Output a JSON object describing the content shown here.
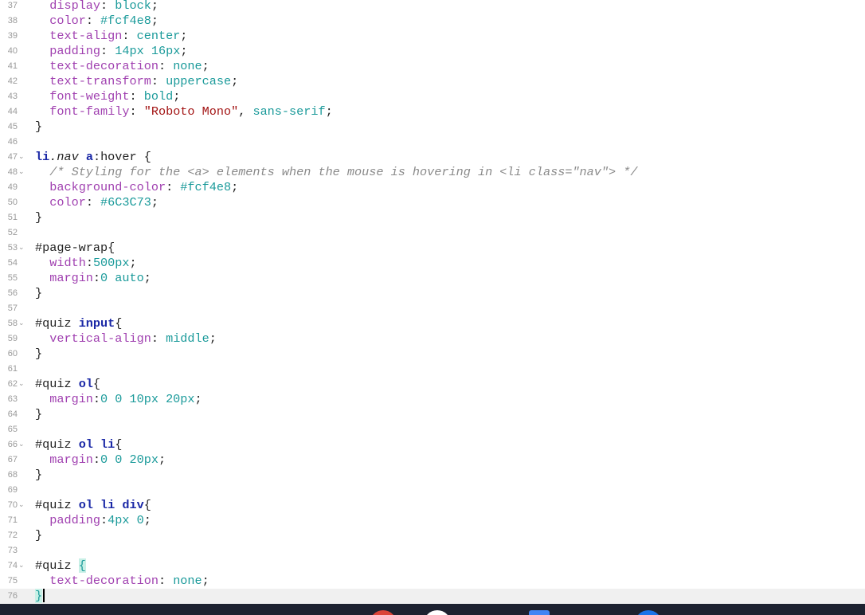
{
  "editor": {
    "lines": [
      {
        "n": "37",
        "fold": "",
        "tokens": [
          [
            "",
            "  "
          ],
          [
            "prop",
            "display"
          ],
          [
            "",
            ": "
          ],
          [
            "val",
            "block"
          ],
          [
            "",
            ";"
          ]
        ]
      },
      {
        "n": "38",
        "fold": "",
        "tokens": [
          [
            "",
            "  "
          ],
          [
            "prop",
            "color"
          ],
          [
            "",
            ": "
          ],
          [
            "val",
            "#fcf4e8"
          ],
          [
            "",
            ";"
          ]
        ]
      },
      {
        "n": "39",
        "fold": "",
        "tokens": [
          [
            "",
            "  "
          ],
          [
            "prop",
            "text-align"
          ],
          [
            "",
            ": "
          ],
          [
            "val",
            "center"
          ],
          [
            "",
            ";"
          ]
        ]
      },
      {
        "n": "40",
        "fold": "",
        "tokens": [
          [
            "",
            "  "
          ],
          [
            "prop",
            "padding"
          ],
          [
            "",
            ": "
          ],
          [
            "val",
            "14px 16px"
          ],
          [
            "",
            ";"
          ]
        ]
      },
      {
        "n": "41",
        "fold": "",
        "tokens": [
          [
            "",
            "  "
          ],
          [
            "prop",
            "text-decoration"
          ],
          [
            "",
            ": "
          ],
          [
            "val",
            "none"
          ],
          [
            "",
            ";"
          ]
        ]
      },
      {
        "n": "42",
        "fold": "",
        "tokens": [
          [
            "",
            "  "
          ],
          [
            "prop",
            "text-transform"
          ],
          [
            "",
            ": "
          ],
          [
            "val",
            "uppercase"
          ],
          [
            "",
            ";"
          ]
        ]
      },
      {
        "n": "43",
        "fold": "",
        "tokens": [
          [
            "",
            "  "
          ],
          [
            "prop",
            "font-weight"
          ],
          [
            "",
            ": "
          ],
          [
            "val",
            "bold"
          ],
          [
            "",
            ";"
          ]
        ]
      },
      {
        "n": "44",
        "fold": "",
        "tokens": [
          [
            "",
            "  "
          ],
          [
            "prop",
            "font-family"
          ],
          [
            "",
            ": "
          ],
          [
            "str",
            "\"Roboto Mono\""
          ],
          [
            "",
            ", "
          ],
          [
            "val",
            "sans-serif"
          ],
          [
            "",
            ";"
          ]
        ]
      },
      {
        "n": "45",
        "fold": "",
        "tokens": [
          [
            "",
            "}"
          ]
        ]
      },
      {
        "n": "46",
        "fold": "",
        "tokens": []
      },
      {
        "n": "47",
        "fold": "⌄",
        "tokens": [
          [
            "kw",
            "li"
          ],
          [
            "cls",
            ".nav"
          ],
          [
            "",
            " "
          ],
          [
            "kw",
            "a"
          ],
          [
            "",
            ":hover {"
          ]
        ]
      },
      {
        "n": "48",
        "fold": "⌄",
        "tokens": [
          [
            "",
            "  "
          ],
          [
            "cmt",
            "/* Styling for the <a> elements when the mouse is hovering in <li class=\"nav\"> */"
          ]
        ]
      },
      {
        "n": "49",
        "fold": "",
        "tokens": [
          [
            "",
            "  "
          ],
          [
            "prop",
            "background-color"
          ],
          [
            "",
            ": "
          ],
          [
            "val",
            "#fcf4e8"
          ],
          [
            "",
            ";"
          ]
        ]
      },
      {
        "n": "50",
        "fold": "",
        "tokens": [
          [
            "",
            "  "
          ],
          [
            "prop",
            "color"
          ],
          [
            "",
            ": "
          ],
          [
            "val",
            "#6C3C73"
          ],
          [
            "",
            ";"
          ]
        ]
      },
      {
        "n": "51",
        "fold": "",
        "tokens": [
          [
            "",
            "}"
          ]
        ]
      },
      {
        "n": "52",
        "fold": "",
        "tokens": []
      },
      {
        "n": "53",
        "fold": "⌄",
        "tokens": [
          [
            "",
            "#page-wrap{"
          ]
        ]
      },
      {
        "n": "54",
        "fold": "",
        "tokens": [
          [
            "",
            "  "
          ],
          [
            "prop",
            "width"
          ],
          [
            "",
            ":"
          ],
          [
            "val",
            "500px"
          ],
          [
            "",
            ";"
          ]
        ]
      },
      {
        "n": "55",
        "fold": "",
        "tokens": [
          [
            "",
            "  "
          ],
          [
            "prop",
            "margin"
          ],
          [
            "",
            ":"
          ],
          [
            "val",
            "0 auto"
          ],
          [
            "",
            ";"
          ]
        ]
      },
      {
        "n": "56",
        "fold": "",
        "tokens": [
          [
            "",
            "}"
          ]
        ]
      },
      {
        "n": "57",
        "fold": "",
        "tokens": []
      },
      {
        "n": "58",
        "fold": "⌄",
        "tokens": [
          [
            "",
            "#quiz "
          ],
          [
            "kw",
            "input"
          ],
          [
            "",
            "{"
          ]
        ]
      },
      {
        "n": "59",
        "fold": "",
        "tokens": [
          [
            "",
            "  "
          ],
          [
            "prop",
            "vertical-align"
          ],
          [
            "",
            ": "
          ],
          [
            "val",
            "middle"
          ],
          [
            "",
            ";"
          ]
        ]
      },
      {
        "n": "60",
        "fold": "",
        "tokens": [
          [
            "",
            "}"
          ]
        ]
      },
      {
        "n": "61",
        "fold": "",
        "tokens": []
      },
      {
        "n": "62",
        "fold": "⌄",
        "tokens": [
          [
            "",
            "#quiz "
          ],
          [
            "kw",
            "ol"
          ],
          [
            "",
            "{"
          ]
        ]
      },
      {
        "n": "63",
        "fold": "",
        "tokens": [
          [
            "",
            "  "
          ],
          [
            "prop",
            "margin"
          ],
          [
            "",
            ":"
          ],
          [
            "val",
            "0 0 10px 20px"
          ],
          [
            "",
            ";"
          ]
        ]
      },
      {
        "n": "64",
        "fold": "",
        "tokens": [
          [
            "",
            "}"
          ]
        ]
      },
      {
        "n": "65",
        "fold": "",
        "tokens": []
      },
      {
        "n": "66",
        "fold": "⌄",
        "tokens": [
          [
            "",
            "#quiz "
          ],
          [
            "kw",
            "ol li"
          ],
          [
            "",
            "{"
          ]
        ]
      },
      {
        "n": "67",
        "fold": "",
        "tokens": [
          [
            "",
            "  "
          ],
          [
            "prop",
            "margin"
          ],
          [
            "",
            ":"
          ],
          [
            "val",
            "0 0 20px"
          ],
          [
            "",
            ";"
          ]
        ]
      },
      {
        "n": "68",
        "fold": "",
        "tokens": [
          [
            "",
            "}"
          ]
        ]
      },
      {
        "n": "69",
        "fold": "",
        "tokens": []
      },
      {
        "n": "70",
        "fold": "⌄",
        "tokens": [
          [
            "",
            "#quiz "
          ],
          [
            "kw",
            "ol li div"
          ],
          [
            "",
            "{"
          ]
        ]
      },
      {
        "n": "71",
        "fold": "",
        "tokens": [
          [
            "",
            "  "
          ],
          [
            "prop",
            "padding"
          ],
          [
            "",
            ":"
          ],
          [
            "val",
            "4px 0"
          ],
          [
            "",
            ";"
          ]
        ]
      },
      {
        "n": "72",
        "fold": "",
        "tokens": [
          [
            "",
            "}"
          ]
        ]
      },
      {
        "n": "73",
        "fold": "",
        "tokens": []
      },
      {
        "n": "74",
        "fold": "⌄",
        "tokens": [
          [
            "",
            "#quiz "
          ],
          [
            "match",
            "{"
          ]
        ]
      },
      {
        "n": "75",
        "fold": "",
        "tokens": [
          [
            "",
            "  "
          ],
          [
            "prop",
            "text-decoration"
          ],
          [
            "",
            ": "
          ],
          [
            "val",
            "none"
          ],
          [
            "",
            ";"
          ]
        ]
      },
      {
        "n": "76",
        "fold": "",
        "active": true,
        "tokens": [
          [
            "match",
            "}"
          ]
        ]
      }
    ]
  },
  "colors": {
    "property": "#a040b0",
    "value": "#1a9a9a",
    "keyword": "#1a28a6",
    "string": "#a31515",
    "comment": "#8a8a8a",
    "taskbar": "#1d2230"
  },
  "taskbar": {
    "icons": [
      {
        "name": "chrome-icon",
        "color": "#db4437"
      },
      {
        "name": "gmail-icon",
        "color": "#ffffff"
      },
      {
        "name": "docs-icon",
        "color": "#4285f4"
      },
      {
        "name": "app-icon",
        "color": "#1a73e8"
      }
    ]
  }
}
